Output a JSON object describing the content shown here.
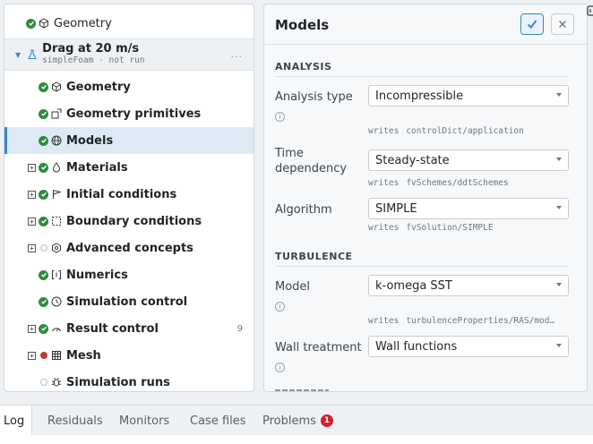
{
  "tree": {
    "root": {
      "label": "Geometry"
    },
    "case": {
      "title": "Drag at 20 m/s",
      "subtitle": "simpleFoam · not run",
      "more": "..."
    },
    "items": [
      {
        "label": "Geometry",
        "status": "ok",
        "expandable": false,
        "icon": "cube-icon"
      },
      {
        "label": "Geometry primitives",
        "status": "ok",
        "expandable": false,
        "icon": "shapes-icon"
      },
      {
        "label": "Models",
        "status": "ok",
        "expandable": false,
        "icon": "globe-icon",
        "selected": true
      },
      {
        "label": "Materials",
        "status": "ok",
        "expandable": true,
        "icon": "droplet-icon"
      },
      {
        "label": "Initial conditions",
        "status": "ok",
        "expandable": true,
        "icon": "flag-icon"
      },
      {
        "label": "Boundary conditions",
        "status": "ok",
        "expandable": true,
        "icon": "boundary-icon"
      },
      {
        "label": "Advanced concepts",
        "status": "none",
        "expandable": true,
        "icon": "hexagon-icon"
      },
      {
        "label": "Numerics",
        "status": "ok",
        "expandable": false,
        "icon": "brackets-icon"
      },
      {
        "label": "Simulation control",
        "status": "ok",
        "expandable": false,
        "icon": "clock-icon"
      },
      {
        "label": "Result control",
        "status": "ok",
        "expandable": true,
        "icon": "gauge-icon",
        "count": "9"
      },
      {
        "label": "Mesh",
        "status": "error",
        "expandable": true,
        "icon": "grid-icon"
      },
      {
        "label": "Simulation runs",
        "status": "none",
        "expandable": false,
        "icon": "bug-icon"
      }
    ]
  },
  "models": {
    "title": "Models",
    "sections": {
      "analysis": "ANALYSIS",
      "turbulence": "TURBULENCE"
    },
    "writes_label": "writes",
    "fields": {
      "analysis_type": {
        "label": "Analysis type",
        "value": "Incompressible",
        "writes": "controlDict/application"
      },
      "time_dependency": {
        "label_line1": "Time",
        "label_line2": "dependency",
        "value": "Steady-state",
        "writes": "fvSchemes/ddtSchemes"
      },
      "algorithm": {
        "label": "Algorithm",
        "value": "SIMPLE",
        "writes": "fvSolution/SIMPLE"
      },
      "model": {
        "label": "Model",
        "value": "k-omega SST",
        "writes": "turbulenceProperties/RAS/mod…"
      },
      "wall_treatment": {
        "label": "Wall treatment",
        "value": "Wall functions"
      }
    }
  },
  "tabs": [
    {
      "label": "Log",
      "active": true
    },
    {
      "label": "Residuals"
    },
    {
      "label": "Monitors"
    },
    {
      "label": "Case files"
    },
    {
      "label": "Problems",
      "badge": "1"
    }
  ],
  "colors": {
    "accent": "#3a86c8",
    "ok": "#2e8b3e",
    "error": "#c0392b",
    "selected_bg": "#ddeaf6"
  }
}
